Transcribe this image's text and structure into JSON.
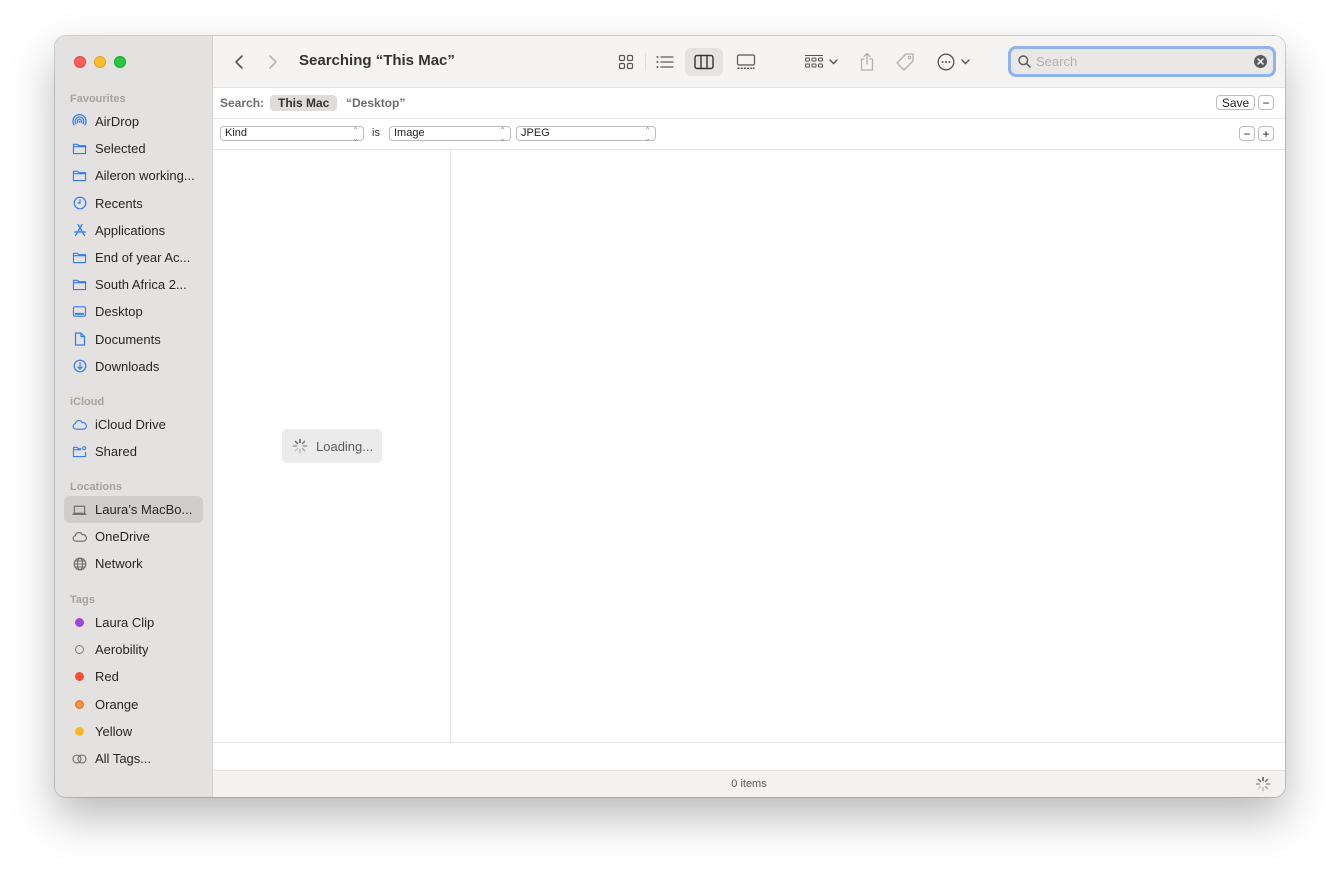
{
  "window": {
    "title": "Searching “This Mac”"
  },
  "sidebar": {
    "favourites_heading": "Favourites",
    "favourites": [
      {
        "label": "AirDrop",
        "icon": "airdrop-icon"
      },
      {
        "label": "Selected",
        "icon": "folder-icon"
      },
      {
        "label": "Aileron working...",
        "icon": "folder-icon"
      },
      {
        "label": "Recents",
        "icon": "clock-icon"
      },
      {
        "label": "Applications",
        "icon": "applications-icon"
      },
      {
        "label": "End of year Ac...",
        "icon": "folder-icon"
      },
      {
        "label": "South Africa 2...",
        "icon": "folder-icon"
      },
      {
        "label": "Desktop",
        "icon": "desktop-icon"
      },
      {
        "label": "Documents",
        "icon": "document-icon"
      },
      {
        "label": "Downloads",
        "icon": "download-icon"
      }
    ],
    "icloud_heading": "iCloud",
    "icloud": [
      {
        "label": "iCloud Drive",
        "icon": "cloud-icon"
      },
      {
        "label": "Shared",
        "icon": "shared-folder-icon"
      }
    ],
    "locations_heading": "Locations",
    "locations": [
      {
        "label": "Laura’s MacBo...",
        "icon": "laptop-icon",
        "selected": true
      },
      {
        "label": "OneDrive",
        "icon": "cloud-icon"
      },
      {
        "label": "Network",
        "icon": "globe-icon"
      }
    ],
    "tags_heading": "Tags",
    "tags": [
      {
        "label": "Laura Clip",
        "color": "#a744d1"
      },
      {
        "label": "Aerobility",
        "color": "none"
      },
      {
        "label": "Red",
        "color": "#fa4e32"
      },
      {
        "label": "Orange",
        "color": "#f7762e"
      },
      {
        "label": "Yellow",
        "color": "#f9b72d"
      },
      {
        "label": "All Tags...",
        "color": "all"
      }
    ]
  },
  "toolbar": {
    "back_label": "Back",
    "forward_label": "Forward",
    "views": [
      "icon-view",
      "list-view",
      "column-view",
      "gallery-view"
    ],
    "active_view": "column-view",
    "group_label": "Group",
    "share_label": "Share",
    "tag_label": "Tags",
    "action_label": "Action"
  },
  "search": {
    "placeholder": "Search",
    "value": ""
  },
  "scope": {
    "label": "Search:",
    "options": [
      "This Mac",
      "“Desktop”"
    ],
    "active": "This Mac",
    "save_label": "Save",
    "remove_label": "−"
  },
  "criteria": {
    "attribute": "Kind",
    "operator": "is",
    "value": "Image",
    "subvalue": "JPEG",
    "remove_label": "−",
    "add_label": "+"
  },
  "content": {
    "loading_text": "Loading..."
  },
  "status": {
    "item_count": "0 items"
  },
  "colors": {
    "accent": "#2f7cf6",
    "sidebar_bg": "#e3e2e1",
    "search_focus": "#8fb3ec"
  }
}
